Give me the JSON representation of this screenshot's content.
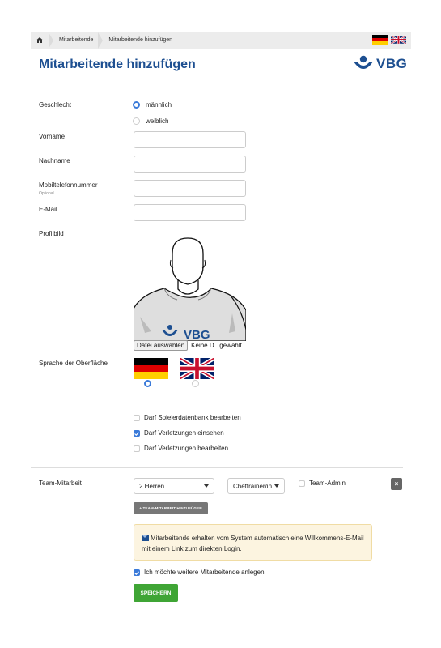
{
  "breadcrumb": {
    "home_icon": "home-icon",
    "items": [
      "Mitarbeitende",
      "Mitarbeitende hinzufügen"
    ]
  },
  "header": {
    "title": "Mitarbeitende hinzufügen",
    "logo_text": "VBG"
  },
  "form": {
    "gender": {
      "label": "Geschlecht",
      "options": [
        "männlich",
        "weiblich"
      ],
      "selected": "männlich"
    },
    "first_name": {
      "label": "Vorname",
      "value": ""
    },
    "last_name": {
      "label": "Nachname",
      "value": ""
    },
    "mobile": {
      "label": "Mobiltelefonnummer",
      "hint": "Optional",
      "value": ""
    },
    "email": {
      "label": "E-Mail",
      "value": ""
    },
    "profile_picture": {
      "label": "Profilbild",
      "file_button": "Datei auswählen",
      "file_status": "Keine D...gewählt",
      "shirt_text": "VBG"
    },
    "language": {
      "label": "Sprache der Oberfläche",
      "options": [
        "de",
        "en"
      ],
      "selected": "de"
    },
    "permissions": [
      {
        "label": "Darf Spielerdatenbank bearbeiten",
        "checked": false
      },
      {
        "label": "Darf Verletzungen einsehen",
        "checked": true
      },
      {
        "label": "Darf Verletzungen bearbeiten",
        "checked": false
      }
    ],
    "team": {
      "label": "Team-Mitarbeit",
      "team_select": "2.Herren",
      "role_select": "Cheftrainer/in",
      "admin_label": "Team-Admin",
      "admin_checked": false,
      "remove_label": "×",
      "add_button": "+ TEAM-MITARBEIT HINZUFÜGEN"
    },
    "info_alert": "Mitarbeitende erhalten vom System automatisch eine Willkommens-E-Mail mit einem Link zum direkten Login.",
    "add_more": {
      "label": "Ich möchte weitere Mitarbeitende anlegen",
      "checked": true
    },
    "save_button": "SPEICHERN"
  },
  "colors": {
    "brand_blue": "#1d4f91",
    "accent_blue": "#3a7ad9",
    "save_green": "#3fa535",
    "alert_bg": "#fcf4e0"
  }
}
